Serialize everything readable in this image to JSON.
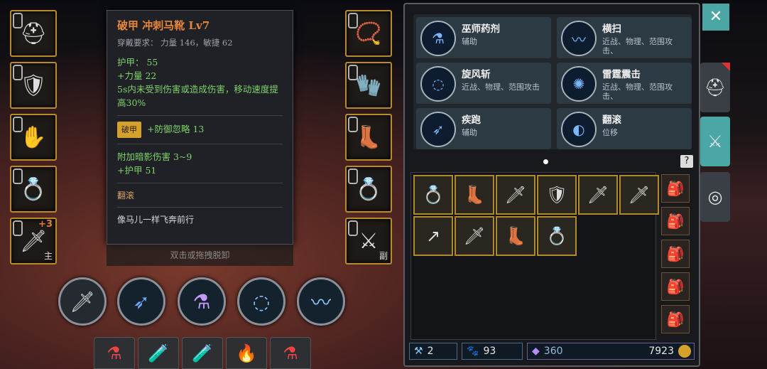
{
  "equipment_left": [
    {
      "name": "helmet",
      "icon": "helmet-icon",
      "glyph": "⛑"
    },
    {
      "name": "armor",
      "icon": "armor-icon",
      "glyph": "🛡"
    },
    {
      "name": "gauntlet",
      "icon": "gauntlet-icon",
      "glyph": "✋"
    },
    {
      "name": "ring",
      "icon": "ring-icon",
      "glyph": "💍"
    },
    {
      "name": "weapon",
      "icon": "sword-icon",
      "glyph": "🗡",
      "badge": "主",
      "plus": "+3"
    }
  ],
  "equipment_right": [
    {
      "name": "amulet",
      "icon": "amulet-icon",
      "glyph": "📿"
    },
    {
      "name": "gloves",
      "icon": "gloves-icon",
      "glyph": "🧤"
    },
    {
      "name": "boots",
      "icon": "boots-icon",
      "glyph": "👢"
    },
    {
      "name": "ring2",
      "icon": "ring-icon",
      "glyph": "💍"
    },
    {
      "name": "offhand",
      "icon": "sword-icon",
      "glyph": "⚔",
      "badge": "副"
    }
  ],
  "tooltip": {
    "title": "破甲 冲刺马靴 Lv7",
    "requirement": "穿戴要求：   力量 146，敏捷 62",
    "stats": [
      "护甲：  55",
      "+力量  22",
      "5s内未受到伤害或造成伤害，移动速度提高30%"
    ],
    "tag": "破甲",
    "tag_effect": "+防御忽略  13",
    "extra": [
      "附加暗影伤害  3~9",
      "+护甲  51"
    ],
    "skill": "翻滚",
    "flavor": "像马儿一样飞奔前行"
  },
  "unequip_hint": "双击或拖拽脱卸",
  "skills": [
    {
      "name": "巫师药剂",
      "desc": "辅助",
      "icon": "potion-skill-icon",
      "glyph": "⚗"
    },
    {
      "name": "横扫",
      "desc": "近战、物理、范围攻击、",
      "icon": "sweep-icon",
      "glyph": "〰"
    },
    {
      "name": "旋风斩",
      "desc": "近战、物理、范围攻击",
      "icon": "whirlwind-icon",
      "glyph": "◌"
    },
    {
      "name": "雷霆震击",
      "desc": "近战、物理、范围攻击、",
      "icon": "thunder-icon",
      "glyph": "✺"
    },
    {
      "name": "疾跑",
      "desc": "辅助",
      "icon": "sprint-icon",
      "glyph": "➶"
    },
    {
      "name": "翻滚",
      "desc": "位移",
      "icon": "roll-icon",
      "glyph": "◐"
    }
  ],
  "inventory": [
    {
      "icon": "ring-icon",
      "glyph": "💍"
    },
    {
      "icon": "boots-icon",
      "glyph": "👢"
    },
    {
      "icon": "sword-icon",
      "glyph": "🗡"
    },
    {
      "icon": "armor-icon",
      "glyph": "🛡"
    },
    {
      "icon": "sword-icon",
      "glyph": "🗡"
    },
    {
      "icon": "sword-icon",
      "glyph": "🗡"
    },
    {
      "icon": "spear-icon",
      "glyph": "↗"
    },
    {
      "icon": "sword-icon",
      "glyph": "🗡"
    },
    {
      "icon": "boots-icon",
      "glyph": "👢"
    },
    {
      "icon": "ring-icon",
      "glyph": "💍"
    }
  ],
  "bags": [
    "🎒",
    "🎒",
    "🎒",
    "🎒",
    "🎒"
  ],
  "stats": {
    "hammer": "2",
    "pet": "93",
    "gem": "360",
    "gold": "7923"
  },
  "close_glyph": "✕"
}
